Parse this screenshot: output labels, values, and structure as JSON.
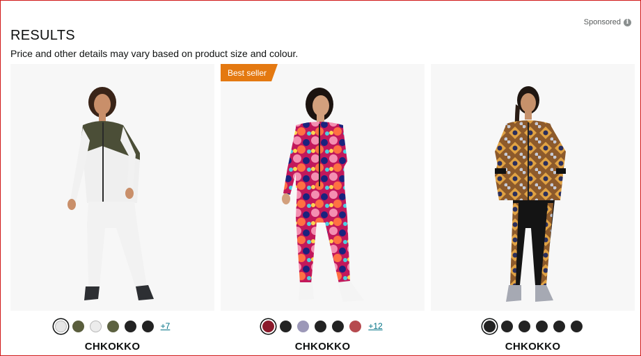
{
  "header": {
    "sponsored_label": "Sponsored",
    "info_icon": "i",
    "title": "RESULTS",
    "subtitle": "Price and other details may vary based on product size and colour."
  },
  "products": [
    {
      "brand": "CHKOKKO",
      "badge": "",
      "swatches": [
        "#e6e6e6",
        "#5a5e3d",
        "#ececec",
        "#5c6140",
        "#232323",
        "#232323"
      ],
      "selected_swatch": 0,
      "more": "+7"
    },
    {
      "brand": "CHKOKKO",
      "badge": "Best seller",
      "swatches": [
        "#8b1a2b",
        "#232323",
        "#9c98b8",
        "#232323",
        "#232323",
        "#b64a4f"
      ],
      "selected_swatch": 0,
      "more": "+12"
    },
    {
      "brand": "CHKOKKO",
      "badge": "",
      "swatches": [
        "#232323",
        "#232323",
        "#232323",
        "#232323",
        "#232323",
        "#232323"
      ],
      "selected_swatch": 0,
      "more": ""
    }
  ],
  "colors": {
    "badge": "#e47911",
    "link": "#007185",
    "frame": "#d01818"
  }
}
